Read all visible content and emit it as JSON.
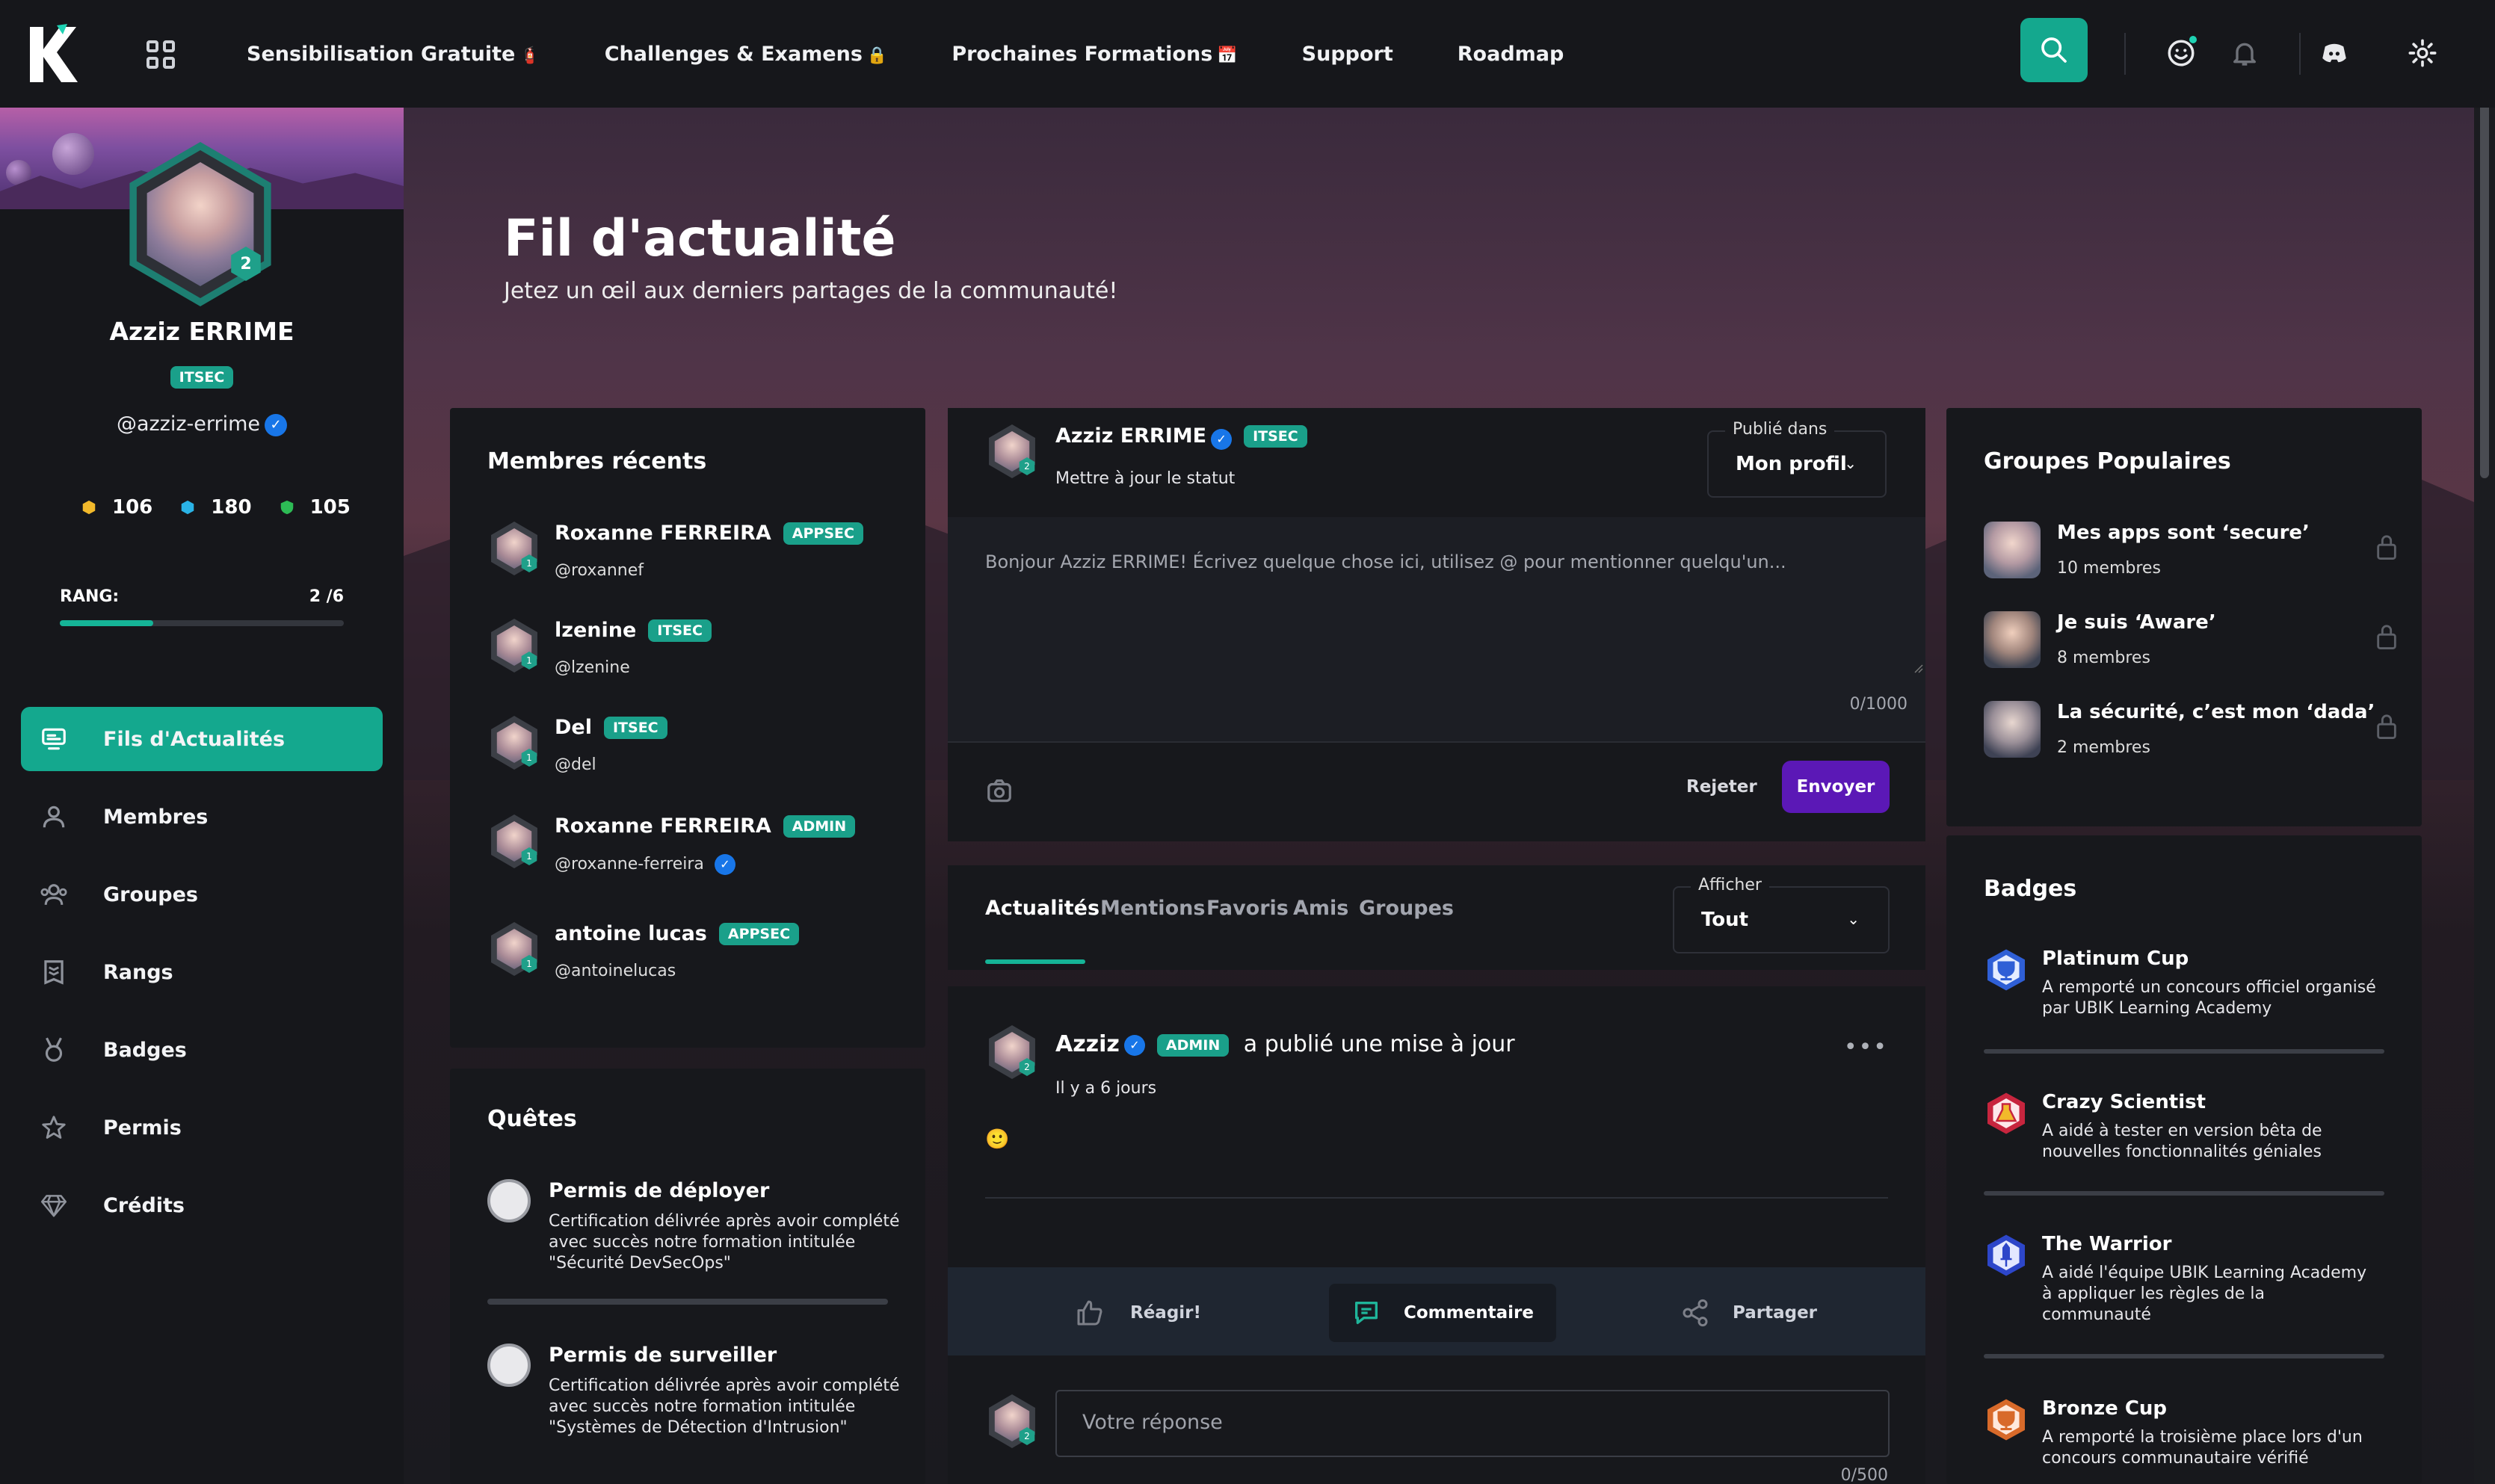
{
  "nav": {
    "links": [
      {
        "label": "Sensibilisation Gratuite",
        "emoji": "🧯"
      },
      {
        "label": "Challenges & Examens",
        "emoji": "🔒"
      },
      {
        "label": "Prochaines Formations",
        "emoji": "📅"
      },
      {
        "label": "Support",
        "emoji": ""
      },
      {
        "label": "Roadmap",
        "emoji": ""
      }
    ]
  },
  "profile": {
    "name": "Azziz ERRIME",
    "tag": "ITSEC",
    "handle": "@azziz-errime",
    "level": "2",
    "stats": [
      "106",
      "180",
      "105"
    ],
    "rank_label": "RANG:",
    "rank_value": "2 /6",
    "rank_progress": 0.33
  },
  "menu": [
    {
      "label": "Fils d'Actualités",
      "active": true
    },
    {
      "label": "Membres"
    },
    {
      "label": "Groupes"
    },
    {
      "label": "Rangs"
    },
    {
      "label": "Badges"
    },
    {
      "label": "Permis"
    },
    {
      "label": "Crédits"
    }
  ],
  "page": {
    "title": "Fil d'actualité",
    "subtitle": "Jetez un œil aux derniers partages de la communauté!"
  },
  "recent_members": {
    "title": "Membres récents",
    "items": [
      {
        "name": "Roxanne FERREIRA",
        "tag": "APPSEC",
        "handle": "@roxannef",
        "level": "1"
      },
      {
        "name": "lzenine",
        "tag": "ITSEC",
        "handle": "@lzenine",
        "level": "1"
      },
      {
        "name": "Del",
        "tag": "ITSEC",
        "handle": "@del",
        "level": "1"
      },
      {
        "name": "Roxanne FERREIRA",
        "tag": "ADMIN",
        "handle": "@roxanne-ferreira",
        "level": "1"
      },
      {
        "name": "antoine lucas",
        "tag": "APPSEC",
        "handle": "@antoinelucas",
        "level": "1"
      }
    ]
  },
  "quests": {
    "title": "Quêtes",
    "items": [
      {
        "title": "Permis de déployer",
        "desc": "Certification délivrée après avoir complété avec succès notre formation intitulée \"Sécurité DevSecOps\""
      },
      {
        "title": "Permis de surveiller",
        "desc": "Certification délivrée après avoir complété avec succès notre formation intitulée \"Systèmes de Détection d'Intrusion\""
      }
    ]
  },
  "composer": {
    "name": "Azziz ERRIME",
    "tag": "ITSEC",
    "status_link": "Mettre à jour le statut",
    "published_in_label": "Publié dans",
    "published_in_value": "Mon profil",
    "placeholder": "Bonjour Azziz ERRIME! Écrivez quelque chose ici, utilisez @ pour mentionner quelqu'un...",
    "counter": "0/1000",
    "reject": "Rejeter",
    "send": "Envoyer"
  },
  "feed_tabs": {
    "tabs": [
      "Actualités",
      "Mentions",
      "Favoris",
      "Amis",
      "Groupes"
    ],
    "show_label": "Afficher",
    "show_value": "Tout"
  },
  "post": {
    "author": "Azziz",
    "tag": "ADMIN",
    "action": "a publié une mise à jour",
    "time": "Il y a 6 jours",
    "content": "🙂",
    "react": "Réagir!",
    "comment": "Commentaire",
    "share": "Partager",
    "reply_placeholder": "Votre réponse",
    "reply_counter": "0/500"
  },
  "groups": {
    "title": "Groupes Populaires",
    "items": [
      {
        "name": "Mes apps sont ‘secure’",
        "count": "10 membres"
      },
      {
        "name": "Je suis ‘Aware’",
        "count": "8 membres"
      },
      {
        "name": "La sécurité, c’est mon ‘dada’",
        "count": "2 membres"
      }
    ]
  },
  "badges": {
    "title": "Badges",
    "items": [
      {
        "name": "Platinum Cup",
        "desc": "A remporté un concours officiel organisé par UBIK Learning Academy",
        "color": "#2f5fd6"
      },
      {
        "name": "Crazy Scientist",
        "desc": "A aidé à tester en version bêta de nouvelles fonctionnalités géniales",
        "color": "#c7253e"
      },
      {
        "name": "The Warrior",
        "desc": "A aidé l'équipe UBIK Learning Academy à appliquer les règles de la communauté",
        "color": "#2d46c9"
      },
      {
        "name": "Bronze Cup",
        "desc": "A remporté la troisième place lors d'un concours communautaire vérifié",
        "color": "#d86a2a"
      }
    ]
  }
}
